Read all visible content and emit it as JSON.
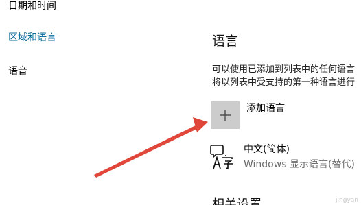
{
  "sidebar": {
    "items": [
      {
        "label": "日期和时间"
      },
      {
        "label": "区域和语言",
        "active": true
      },
      {
        "label": "语音"
      }
    ],
    "active_color": "#0b6a9b"
  },
  "main": {
    "section_title": "语言",
    "description_lines": [
      "可以使用已添加到列表中的任何语言",
      "将以列表中受支持的第一种语言进行"
    ],
    "add_language": {
      "icon": "plus-icon",
      "label": "添加语言"
    },
    "languages": [
      {
        "name": "中文(简体)",
        "subtitle": "Windows 显示语言(替代)",
        "icon": "language-icon"
      }
    ],
    "related_settings_title": "相关设置"
  },
  "annotation": {
    "arrow_color": "#e0463a"
  },
  "watermark": "jingyan"
}
